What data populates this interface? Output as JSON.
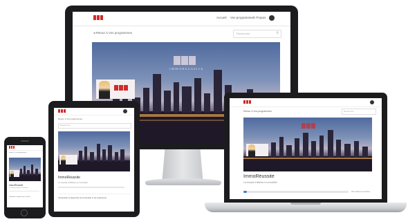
{
  "desktop": {
    "nav": {
      "item1": "Accueil",
      "item2": "Vos programmes",
      "item3": "À Propos"
    },
    "back_link": "Retour à Vos programmes",
    "search_placeholder": "Recherche",
    "brand_overlay": "IMMORÉUSSITE"
  },
  "laptop": {
    "back_link": "Retour à Vos programmes",
    "search_placeholder": "Recherche",
    "program_title": "ImmoRéussite",
    "program_subtitle": "La réussite d'affaires en immobilier",
    "progress_label": "0% Vidéos écoutées",
    "progress_percent": 3
  },
  "tablet": {
    "back_link": "Retour à Vos programmes",
    "search_placeholder": "Recherche",
    "program_title": "ImmoRéussite",
    "program_subtitle": "La réussite d'affaires en immobilier",
    "list_item": "Introduction à l'approche de la réussite et du programme"
  },
  "phone": {
    "back_link": "Retour à Vos programmes",
    "program_title": "ImmoRéussite",
    "program_subtitle": "La réussite d'affaires en immobilier",
    "list_item": "Introduction à l'approche de la réussite"
  },
  "colors": {
    "brand": "#d12a2a",
    "accent": "#3b7dd8",
    "frame": "#1c1c1e",
    "silver": "#d9dadc"
  }
}
